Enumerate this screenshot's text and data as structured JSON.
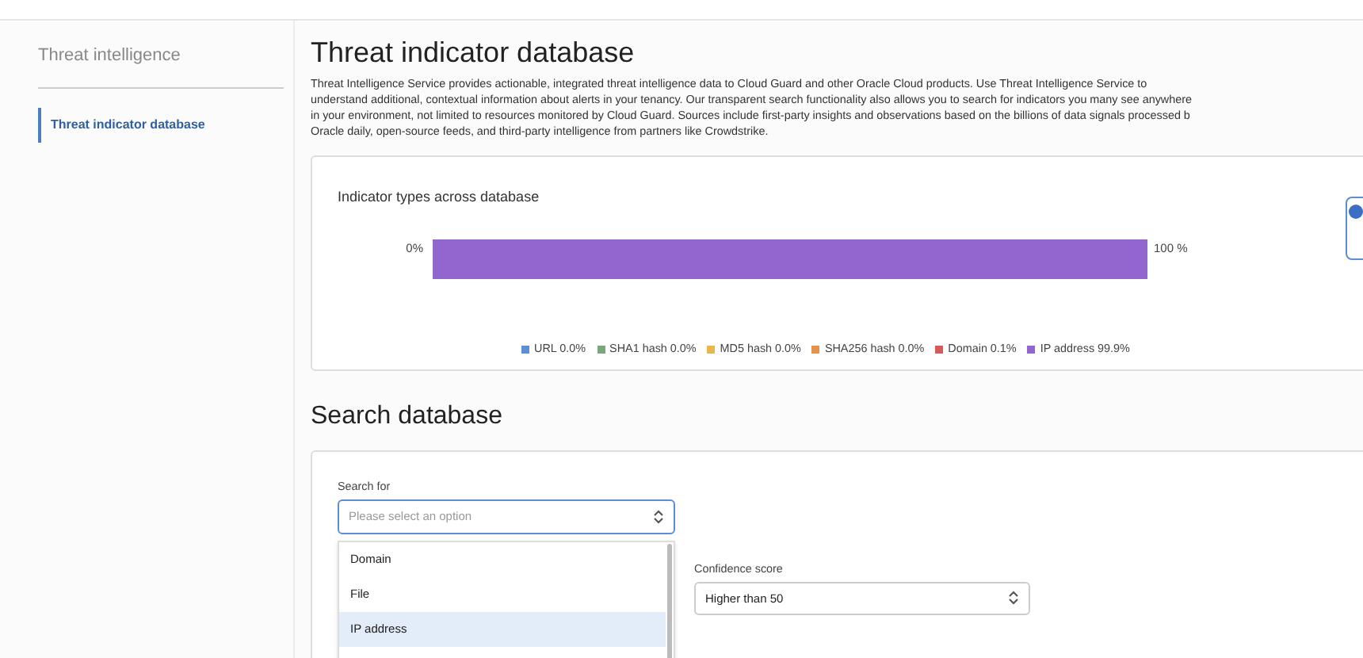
{
  "sidebar": {
    "title": "Threat intelligence",
    "items": [
      {
        "label": "Threat indicator database",
        "selected": true
      }
    ]
  },
  "page": {
    "title": "Threat indicator database",
    "description_lines": [
      "Threat Intelligence Service provides actionable, integrated threat intelligence data to Cloud Guard and other Oracle Cloud products. Use Threat Intelligence Service to",
      "understand additional, contextual information about alerts in your tenancy. Our transparent search functionality also allows you to search for indicators you many see anywhere",
      "in your environment, not limited to resources monitored by Cloud Guard. Sources include first-party insights and observations based on the billions of data signals processed b",
      "Oracle daily, open-source feeds, and third-party intelligence from partners like Crowdstrike."
    ]
  },
  "chart_card": {
    "title": "Indicator types across database",
    "bar_start_label": "0%",
    "bar_end_label": "100 %",
    "segments": [
      {
        "label": "URL 0.0%",
        "color": "#5b8fd6"
      },
      {
        "label": "SHA1 hash 0.0%",
        "color": "#7aa87a"
      },
      {
        "label": "MD5 hash 0.0%",
        "color": "#e8b84a"
      },
      {
        "label": "SHA256 hash 0.0%",
        "color": "#e8914a"
      },
      {
        "label": "Domain 0.1%",
        "color": "#d65a5a"
      },
      {
        "label": "IP address 99.9%",
        "color": "#9266cf"
      }
    ]
  },
  "search": {
    "title": "Search database",
    "search_for": {
      "label": "Search for",
      "placeholder": "Please select an option",
      "expanded": true,
      "options": [
        {
          "label": "Domain",
          "selected": false
        },
        {
          "label": "File",
          "selected": false
        },
        {
          "label": "IP address",
          "selected": true
        }
      ]
    },
    "confidence": {
      "label": "Confidence score",
      "value": "Higher than 50"
    }
  }
}
